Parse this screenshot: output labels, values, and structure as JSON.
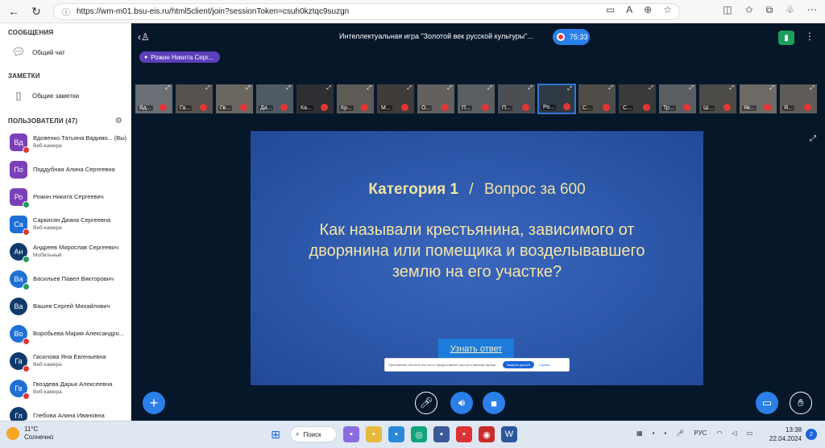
{
  "browser": {
    "url": "https://wm-m01.bsu-eis.ru/html5client/join?sessionToken=csuh0kztqc9suzgn"
  },
  "sidebar": {
    "messages_heading": "СООБЩЕНИЯ",
    "public_chat": "Общий чат",
    "notes_heading": "ЗАМЕТКИ",
    "shared_notes": "Общие заметки",
    "users_heading": "ПОЛЬЗОВАТЕЛИ (47)",
    "users": [
      {
        "initials": "Вд",
        "name": "Вдовенко Татьяна Вадимо... (Вы)",
        "sub": "Веб-камера",
        "color": "#7b3fb9",
        "status": "#e23636",
        "round": false
      },
      {
        "initials": "По",
        "name": "Поддубная Алина Сергеевна",
        "sub": "",
        "color": "#7b3fb9",
        "status": "",
        "round": false
      },
      {
        "initials": "Ро",
        "name": "Рожин Никита Сергеевич",
        "sub": "",
        "color": "#7b3fb9",
        "status": "#1e9e5a",
        "round": false
      },
      {
        "initials": "Са",
        "name": "Саркисян Диана Сергеевна",
        "sub": "Веб-камера",
        "color": "#1e70d6",
        "status": "#e23636",
        "round": false
      },
      {
        "initials": "Ан",
        "name": "Андреев Мирослав Сергеевич",
        "sub": "Мобильный",
        "color": "#0f3a6b",
        "status": "#1e9e5a",
        "round": true
      },
      {
        "initials": "Ва",
        "name": "Васильев Павел Викторович",
        "sub": "",
        "color": "#1e70d6",
        "status": "#1e9e5a",
        "round": true
      },
      {
        "initials": "Ва",
        "name": "Вашев Сергей Михайлович",
        "sub": "",
        "color": "#0f3a6b",
        "status": "",
        "round": true
      },
      {
        "initials": "Во",
        "name": "Воробьева Мария Александро...",
        "sub": "",
        "color": "#1e70d6",
        "status": "#e23636",
        "round": true
      },
      {
        "initials": "Га",
        "name": "Гасилова Яна Евгеньевна",
        "sub": "Веб-камера",
        "color": "#0f3a6b",
        "status": "#e23636",
        "round": true
      },
      {
        "initials": "Гв",
        "name": "Гвоздева Дарья Алексеевна",
        "sub": "Веб-камера",
        "color": "#1e70d6",
        "status": "#e23636",
        "round": true
      },
      {
        "initials": "Гл",
        "name": "Глебова Алина Ивановна",
        "sub": "",
        "color": "#0f3a6b",
        "status": "#e23636",
        "round": true
      }
    ]
  },
  "meeting": {
    "title": "Интеллектуальная игра \"Золотой век русской культуры\"...",
    "timer": "75:33",
    "talker": "Рожин Никита Серг..."
  },
  "webcams": [
    {
      "name": "Вд..."
    },
    {
      "name": "Га..."
    },
    {
      "name": "Гв..."
    },
    {
      "name": "Да..."
    },
    {
      "name": "Ка..."
    },
    {
      "name": "Кр..."
    },
    {
      "name": "М..."
    },
    {
      "name": "О..."
    },
    {
      "name": "П..."
    },
    {
      "name": "П..."
    },
    {
      "name": "Ро..."
    },
    {
      "name": "С..."
    },
    {
      "name": "С..."
    },
    {
      "name": "Тр..."
    },
    {
      "name": "Ш..."
    },
    {
      "name": "Як..."
    },
    {
      "name": "Я..."
    }
  ],
  "slide": {
    "category": "Категория 1",
    "separator": "/",
    "question_value": "Вопрос за 600",
    "question": "Как называли крестьянина, зависимого от дворянина или помещика и возделывавшего землю на его участке?",
    "answer_button": "Узнать ответ",
    "share_note": "Приложение wm-m01.bsu-eis.ru предоставляет доступ к вашему экрану.",
    "share_stop": "Закрыть доступ",
    "share_hide": "Скрыть"
  },
  "taskbar": {
    "temperature": "11°C",
    "weather": "Солнечно",
    "search": "Поиск",
    "lang": "РУС",
    "time": "13:38",
    "date": "22.04.2024",
    "notifications": "2"
  }
}
